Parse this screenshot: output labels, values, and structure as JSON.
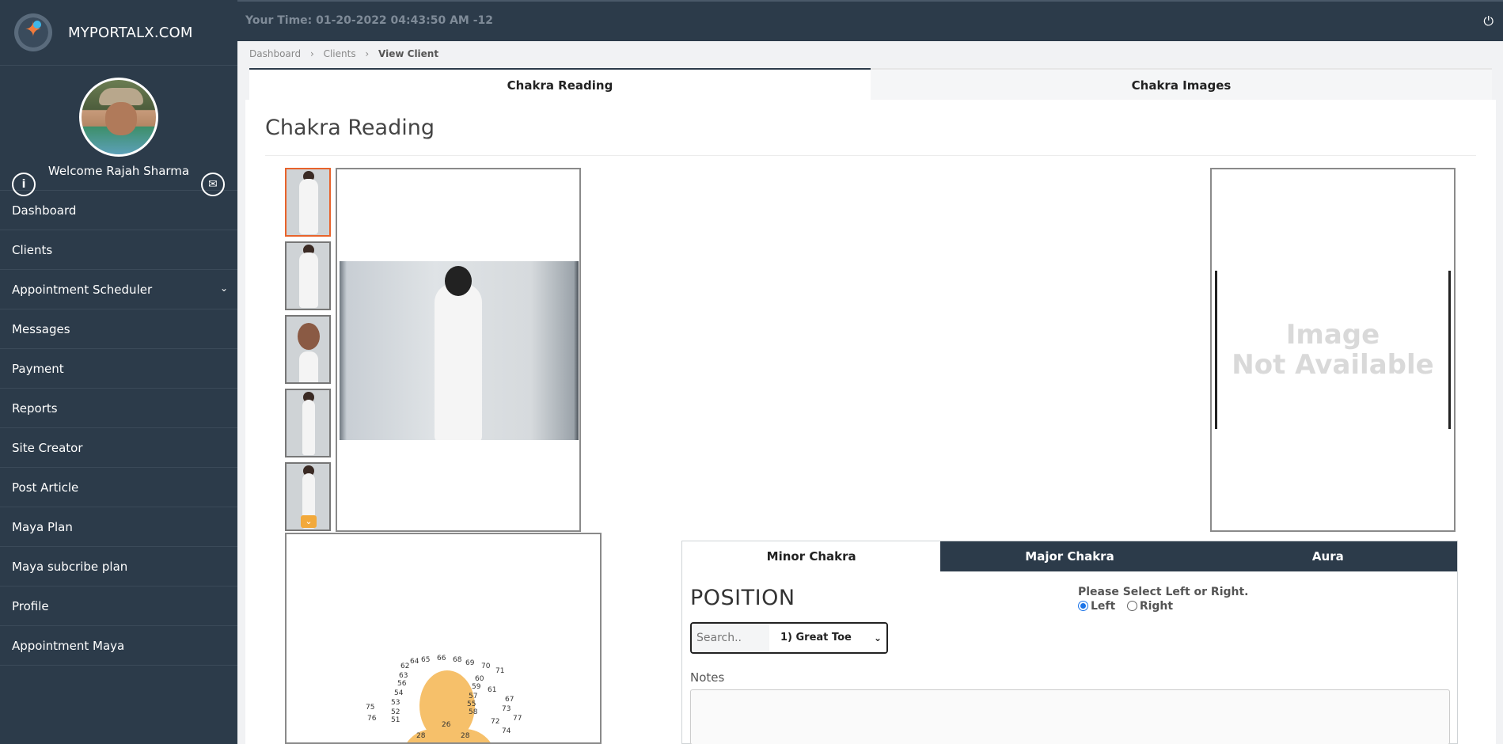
{
  "brand": {
    "name": "MYPORTALX.COM"
  },
  "profile": {
    "welcome": "Welcome Rajah Sharma"
  },
  "sidebar": {
    "items": [
      {
        "label": "Dashboard"
      },
      {
        "label": "Clients"
      },
      {
        "label": "Appointment Scheduler"
      },
      {
        "label": "Messages"
      },
      {
        "label": "Payment"
      },
      {
        "label": "Reports"
      },
      {
        "label": "Site Creator"
      },
      {
        "label": "Post Article"
      },
      {
        "label": "Maya Plan"
      },
      {
        "label": "Maya subcribe plan"
      },
      {
        "label": "Profile"
      },
      {
        "label": "Appointment Maya"
      }
    ]
  },
  "topbar": {
    "time": "Your Time: 01-20-2022 04:43:50 AM -12"
  },
  "breadcrumb": {
    "items": [
      "Dashboard",
      "Clients",
      "View Client"
    ]
  },
  "tabs": [
    {
      "label": "Chakra Reading"
    },
    {
      "label": "Chakra Images"
    }
  ],
  "main": {
    "title": "Chakra Reading",
    "image_unavailable": {
      "line1": "Image",
      "line2": "Not Available"
    }
  },
  "subtabs": [
    {
      "label": "Minor Chakra"
    },
    {
      "label": "Major Chakra"
    },
    {
      "label": "Aura"
    }
  ],
  "position": {
    "title": "POSITION",
    "search_placeholder": "Search..",
    "selected": "1) Great Toe",
    "lr_label": "Please Select Left or Right.",
    "left": "Left",
    "right": "Right",
    "notes_label": "Notes"
  },
  "chakra_numbers": [
    "62",
    "64",
    "65",
    "66",
    "68",
    "69",
    "70",
    "71",
    "63",
    "60",
    "56",
    "59",
    "61",
    "54",
    "57",
    "67",
    "53",
    "55",
    "75",
    "52",
    "58",
    "73",
    "76",
    "51",
    "72",
    "77",
    "26",
    "74",
    "28",
    "28"
  ],
  "colors": {
    "sidebar": "#2c3b4a",
    "accent": "#e8632b",
    "chakra": "#f6c06a",
    "radio": "#1a73e8"
  }
}
